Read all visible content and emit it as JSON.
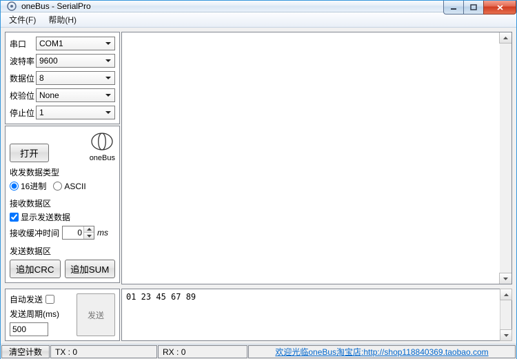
{
  "window": {
    "title": "oneBus - SerialPro"
  },
  "menu": {
    "file": "文件(F)",
    "help": "帮助(H)"
  },
  "serial": {
    "port_label": "串口",
    "port_value": "COM1",
    "baud_label": "波特率",
    "baud_value": "9600",
    "data_label": "数据位",
    "data_value": "8",
    "parity_label": "校验位",
    "parity_value": "None",
    "stop_label": "停止位",
    "stop_value": "1"
  },
  "open_btn": "打开",
  "logo_name": "oneBus",
  "data_type": {
    "section": "收发数据类型",
    "hex": "16进制",
    "ascii": "ASCII"
  },
  "recv": {
    "section": "接收数据区",
    "show_send": "显示发送数据",
    "buffer_label": "接收缓冲时间",
    "buffer_value": "0",
    "buffer_unit": "ms"
  },
  "send": {
    "section": "发送数据区",
    "crc_btn": "追加CRC",
    "sum_btn": "追加SUM"
  },
  "auto": {
    "label": "自动发送",
    "period_label": "发送周期(ms)",
    "period_value": "500",
    "send_btn": "发送"
  },
  "sendbox": {
    "content": "01 23 45 67 89"
  },
  "status": {
    "clear": "清空计数",
    "tx_label": "TX :",
    "tx_value": "0",
    "rx_label": "RX :",
    "rx_value": "0",
    "link_text": "欢迎光临oneBus淘宝店:http://shop118840369.taobao.com"
  }
}
